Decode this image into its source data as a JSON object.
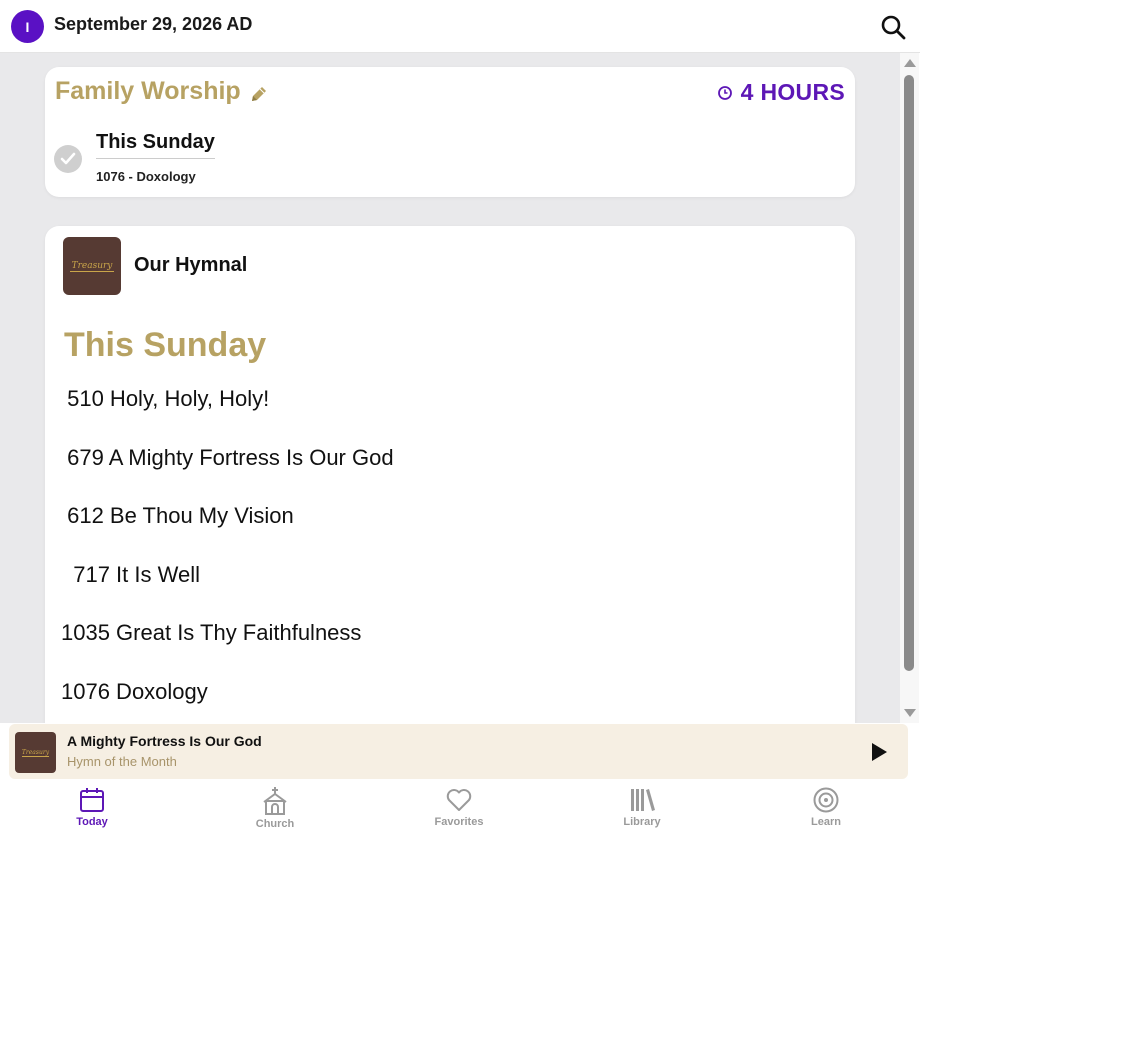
{
  "header": {
    "avatar_initial": "I",
    "date": "September 29, 2026 AD",
    "search_icon": "search-icon"
  },
  "family_worship": {
    "title": "Family Worship",
    "time_remaining": "4 HOURS",
    "service_name": "This Sunday",
    "hymn_summary": "1076 - Doxology",
    "colors": {
      "gold": "#b7a263",
      "purple": "#5d17b6"
    }
  },
  "hymnal": {
    "name": "Our Hymnal",
    "logo_text": "Treasury",
    "section_heading": "This Sunday",
    "hymns": [
      " 510 Holy, Holy, Holy!",
      " 679 A Mighty Fortress Is Our God",
      " 612 Be Thou My Vision",
      "  717 It Is Well",
      "1035 Great Is Thy Faithfulness",
      "1076 Doxology"
    ]
  },
  "player": {
    "title": "A Mighty Fortress Is Our God",
    "subtitle": "Hymn of the Month",
    "art_text": "Treasury"
  },
  "nav": {
    "items": [
      {
        "label": "Today",
        "icon": "calendar-icon",
        "active": true
      },
      {
        "label": "Church",
        "icon": "church-icon",
        "active": false
      },
      {
        "label": "Favorites",
        "icon": "heart-icon",
        "active": false
      },
      {
        "label": "Library",
        "icon": "library-icon",
        "active": false
      },
      {
        "label": "Learn",
        "icon": "target-icon",
        "active": false
      }
    ]
  }
}
